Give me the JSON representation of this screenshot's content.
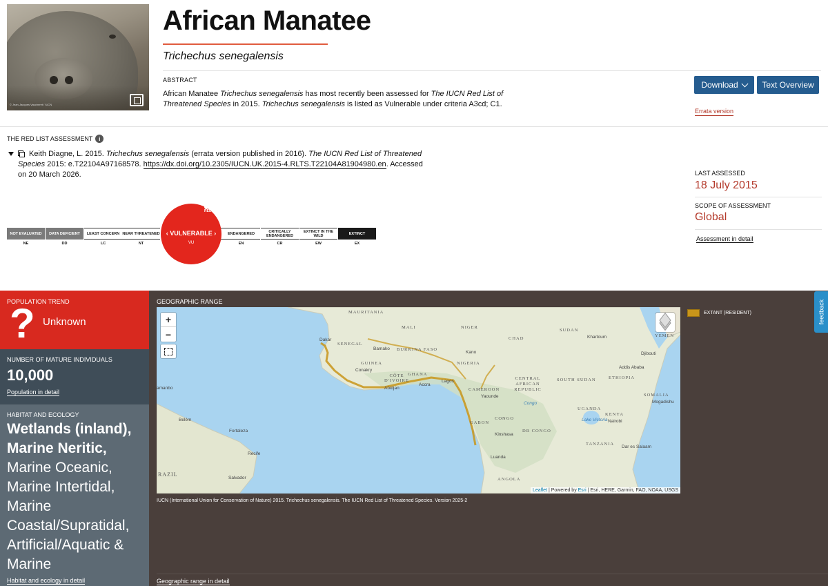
{
  "header": {
    "title": "African Manatee",
    "scientific_name": "Trichechus senegalensis",
    "photo_credit": "© Jean-Jacques Vaucheret / IUCN",
    "abstract_heading": "ABSTRACT",
    "abstract": {
      "p1": "African Manatee ",
      "p1i": "Trichechus senegalensis",
      "p2": " has most recently been assessed for ",
      "p2i": "The IUCN Red List of Threatened Species",
      "p3": " in 2015. ",
      "p3i": "Trichechus senegalensis",
      "p4": " is listed as Vulnerable under criteria A3cd; C1."
    },
    "download_label": "Download",
    "text_overview_label": "Text Overview",
    "errata_label": "Errata version"
  },
  "assessment": {
    "heading": "THE RED LIST ASSESSMENT",
    "info_icon": "i",
    "citation": {
      "a": "Keith Diagne, L. 2015. ",
      "ai": "Trichechus senegalensis",
      "b": " (errata version published in 2016). ",
      "bi": "The IUCN Red List of Threatened Species",
      "c": " 2015: e.T22104A97168578. ",
      "doi": "https://dx.doi.org/10.2305/IUCN.UK.2015-4.RLTS.T22104A81904980.en",
      "d": ". Accessed on 20 March 2026."
    },
    "last_assessed_label": "LAST ASSESSED",
    "last_assessed_value": "18 July 2015",
    "scope_label": "SCOPE OF ASSESSMENT",
    "scope_value": "Global",
    "detail_link": "Assessment in detail",
    "categories": [
      {
        "label": "NOT EVALUATED",
        "abbr": "NE"
      },
      {
        "label": "DATA DEFICIENT",
        "abbr": "DD"
      },
      {
        "label": "LEAST CONCERN",
        "abbr": "LC"
      },
      {
        "label": "NEAR THREATENED",
        "abbr": "NT"
      },
      {
        "label": "VULNERABLE",
        "abbr": "VU"
      },
      {
        "label": "ENDANGERED",
        "abbr": "EN"
      },
      {
        "label": "CRITICALLY ENDANGERED",
        "abbr": "CR"
      },
      {
        "label": "EXTINCT IN THE WILD",
        "abbr": "EW"
      },
      {
        "label": "EXTINCT",
        "abbr": "EX"
      }
    ],
    "vu_display": "‹ VULNERABLE ›",
    "red_list_logo_text": "RED LIST"
  },
  "population": {
    "label": "POPULATION TREND",
    "icon": "?",
    "value": "Unknown",
    "color": "#d8291f"
  },
  "mature": {
    "label": "NUMBER OF MATURE INDIVIDUALS",
    "value": "10,000",
    "link": "Population in detail"
  },
  "habitat": {
    "label": "HABITAT AND ECOLOGY",
    "bold": "Wetlands (inland), Marine Neritic,",
    "rest": " Marine Oceanic, Marine Intertidal, Marine Coastal/Supratidal, Artificial/Aquatic & Marine",
    "link": "Habitat and ecology in detail"
  },
  "geo": {
    "label": "GEOGRAPHIC RANGE",
    "zoom_in": "+",
    "zoom_out": "−",
    "legend_label": "EXTANT (RESIDENT)",
    "legend_color": "#c8951a",
    "caption": "IUCN (International Union for Conservation of Nature) 2015. Trichechus senegalensis. The IUCN Red List of Threatened Species. Version 2025-2",
    "link": "Geographic range in detail",
    "attribution": {
      "leaflet": "Leaflet",
      "sep1": " | Powered by ",
      "esri": "Esri",
      "rest": " | Esri, HERE, Garmin, FAO, NOAA, USGS"
    },
    "countries": [
      "MAURITANIA",
      "MALI",
      "NIGER",
      "CHAD",
      "SUDAN",
      "SENEGAL",
      "BURKINA FASO",
      "GUINEA",
      "NIGERIA",
      "CÔTE D'IVOIRE",
      "GHANA",
      "CENTRAL AFRICAN REPUBLIC",
      "SOUTH SUDAN",
      "ETHIOPIA",
      "CAMEROON",
      "SOMALIA",
      "GABON",
      "CONGO",
      "DR CONGO",
      "UGANDA",
      "KENYA",
      "TANZANIA",
      "ANGOLA",
      "YEMEN",
      "RAZIL"
    ],
    "cities": [
      "Dakar",
      "Bamako",
      "Kano",
      "Conakry",
      "Abidjan",
      "Accra",
      "Lagos",
      "Yaounde",
      "Khartoum",
      "Addis Ababa",
      "Djibouti",
      "Mogadishu",
      "Nairobi",
      "Kinshasa",
      "Luanda",
      "Dar es Salaam",
      "Fortaleza",
      "Recife",
      "Salvador",
      "Belém",
      "amanbo",
      "Lake Victoria",
      "Congo"
    ]
  },
  "feedback_label": "feedback"
}
